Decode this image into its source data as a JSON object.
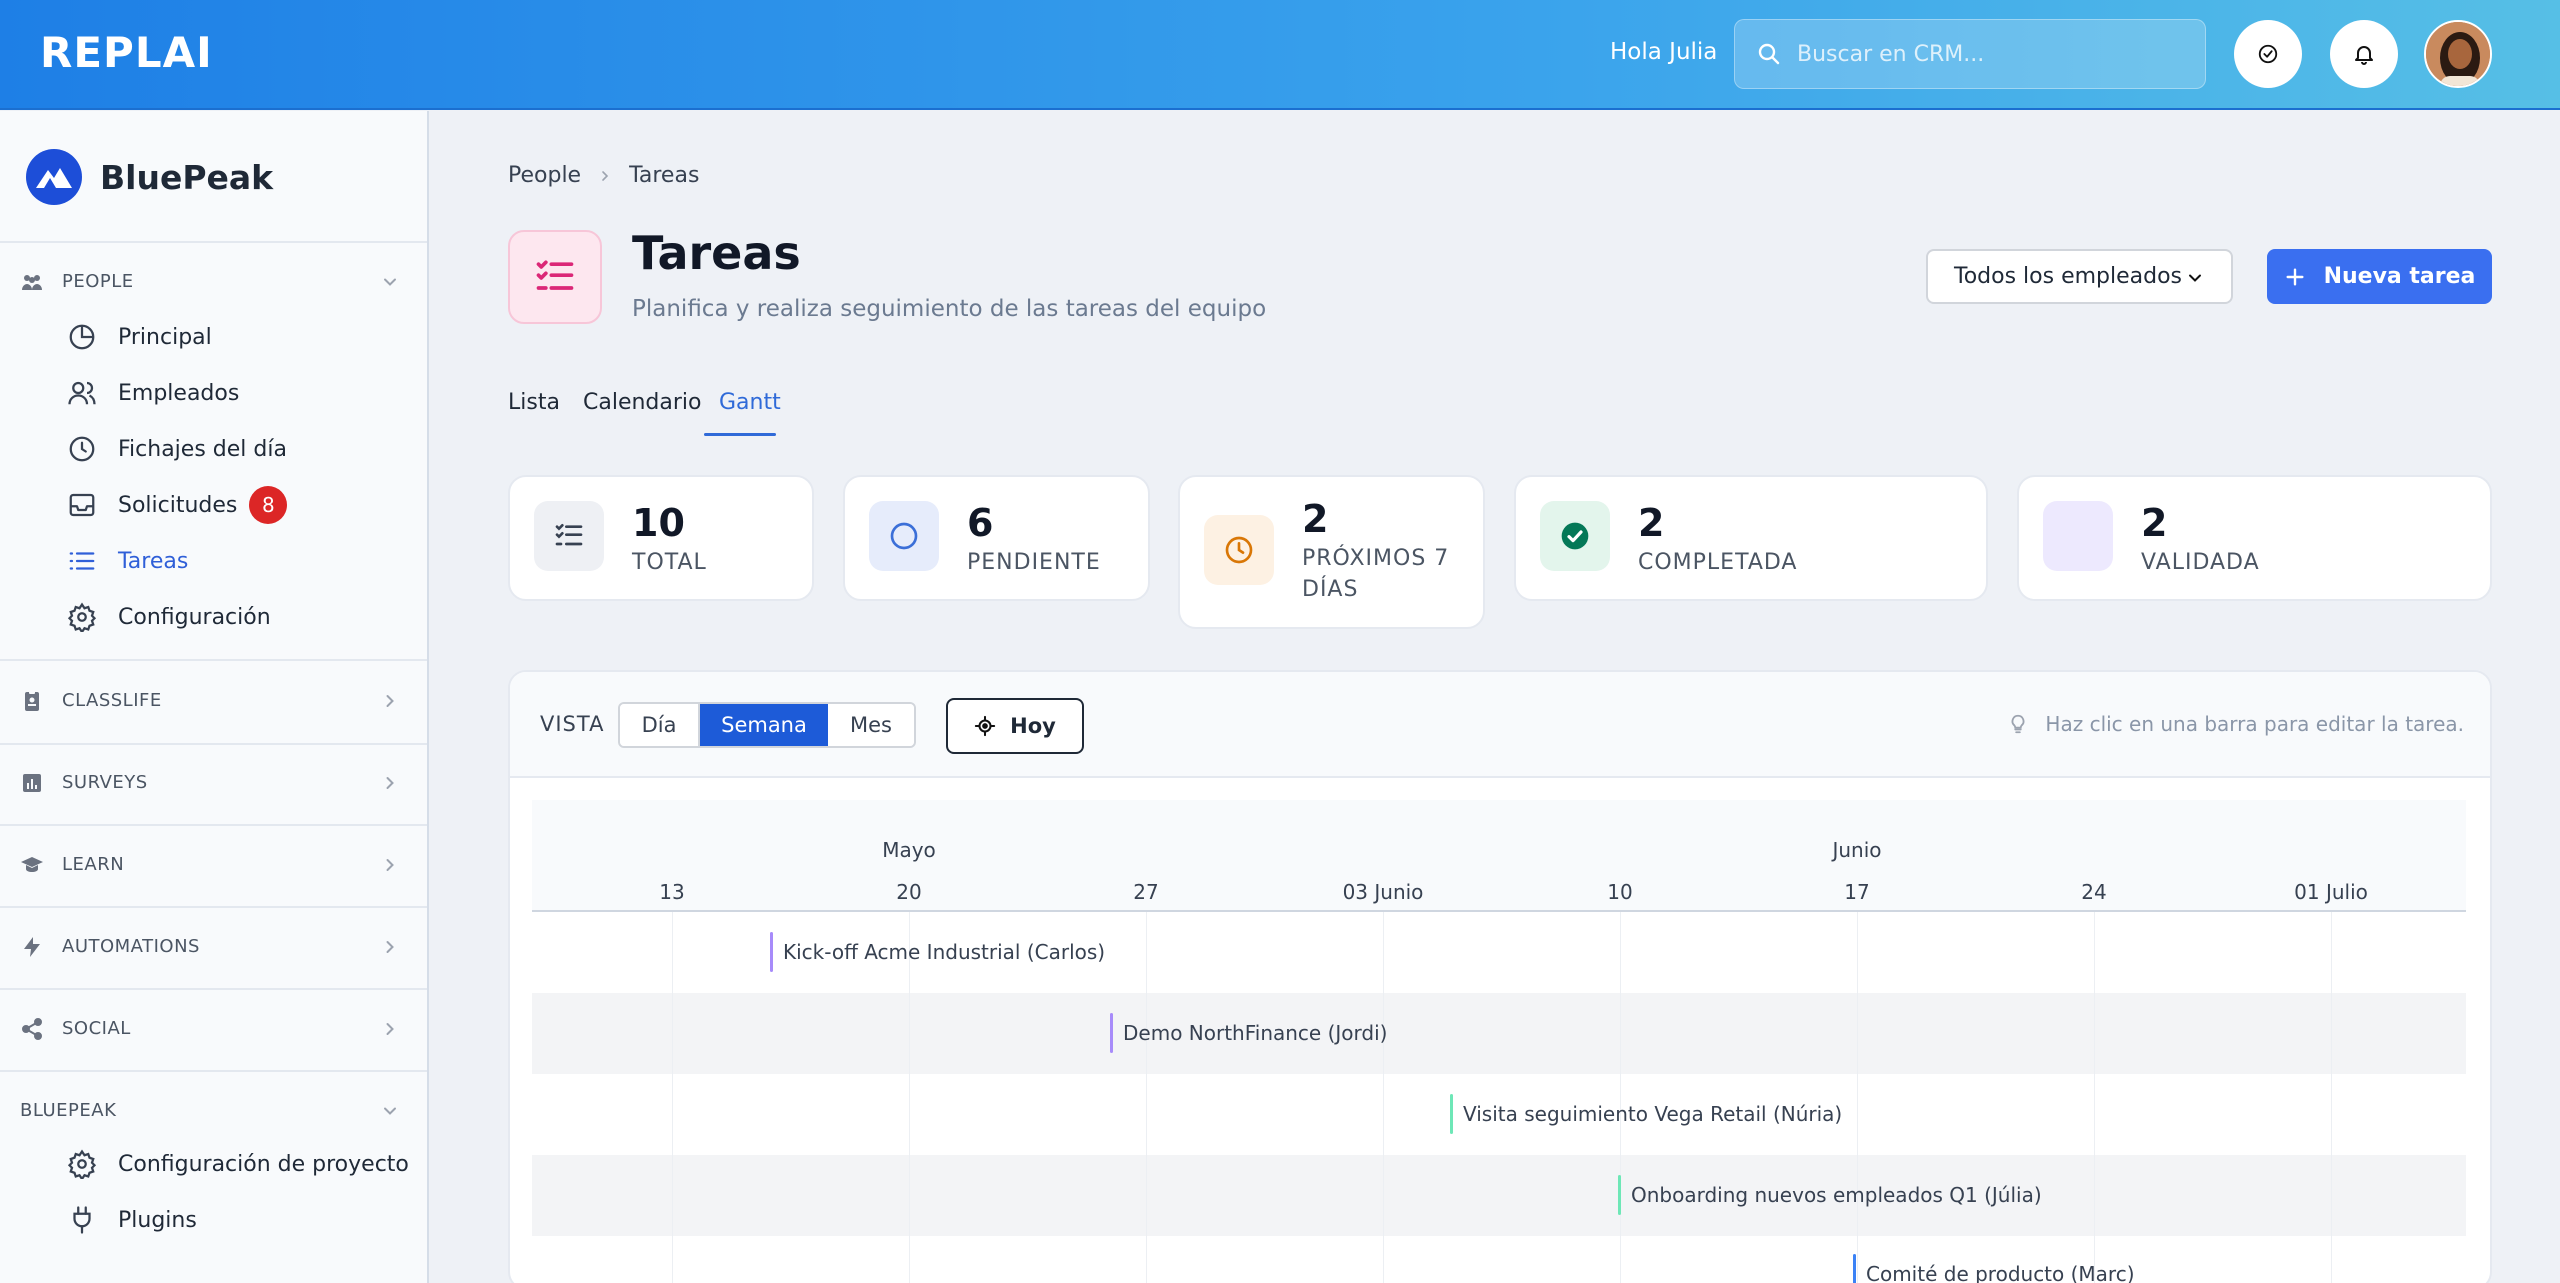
{
  "app": {
    "logo_text": "REPLAI",
    "greeting": "Hola Julia",
    "search_placeholder": "Buscar en CRM..."
  },
  "sidebar": {
    "brand": "BluePeak",
    "people_section": {
      "label": "PEOPLE",
      "items": [
        {
          "label": "Principal",
          "icon": "pie-chart-icon"
        },
        {
          "label": "Empleados",
          "icon": "users-icon"
        },
        {
          "label": "Fichajes del día",
          "icon": "clock-icon"
        },
        {
          "label": "Solicitudes",
          "icon": "inbox-icon",
          "badge": "8"
        },
        {
          "label": "Tareas",
          "icon": "list-icon",
          "active": true
        },
        {
          "label": "Configuración",
          "icon": "gear-icon"
        }
      ]
    },
    "collapsed_sections": [
      {
        "label": "CLASSLIFE",
        "icon": "badge-icon"
      },
      {
        "label": "SURVEYS",
        "icon": "bar-chart-icon"
      },
      {
        "label": "LEARN",
        "icon": "graduation-cap-icon"
      },
      {
        "label": "AUTOMATIONS",
        "icon": "lightning-icon"
      },
      {
        "label": "SOCIAL",
        "icon": "share-icon"
      }
    ],
    "bluepeak_section": {
      "label": "BLUEPEAK",
      "items": [
        {
          "label": "Configuración de proyecto",
          "icon": "gear-icon"
        },
        {
          "label": "Plugins",
          "icon": "plug-icon"
        }
      ]
    }
  },
  "page": {
    "breadcrumb": [
      "People",
      "Tareas"
    ],
    "title": "Tareas",
    "subtitle": "Planifica y realiza seguimiento de las tareas del equipo",
    "employee_filter": "Todos los empleados",
    "new_task_label": "Nueva tarea",
    "tabs": [
      {
        "label": "Lista"
      },
      {
        "label": "Calendario"
      },
      {
        "label": "Gantt",
        "active": true
      }
    ],
    "stats": [
      {
        "value": "10",
        "label": "TOTAL",
        "icon": "checklist-icon"
      },
      {
        "value": "6",
        "label": "PENDIENTE",
        "icon": "circle-icon"
      },
      {
        "value": "2",
        "label": "PRÓXIMOS 7 DÍAS",
        "icon": "clock-icon"
      },
      {
        "value": "2",
        "label": "COMPLETADA",
        "icon": "check-circle-icon"
      },
      {
        "value": "2",
        "label": "VALIDADA",
        "icon": "blank-icon"
      }
    ]
  },
  "gantt": {
    "view_label": "VISTA",
    "view_options": [
      "Día",
      "Semana",
      "Mes"
    ],
    "view_selected": "Semana",
    "today_label": "Hoy",
    "hint": "Haz clic en una barra para editar la tarea.",
    "months": [
      "Mayo",
      "Junio"
    ],
    "weeks": [
      "13",
      "20",
      "27",
      "03 Junio",
      "10",
      "17",
      "24",
      "01 Julio"
    ],
    "tasks": [
      {
        "label": "Kick-off Acme Industrial (Carlos)",
        "color": "#a78bfa"
      },
      {
        "label": "Demo NorthFinance (Jordi)",
        "color": "#a78bfa"
      },
      {
        "label": "Visita seguimiento Vega Retail (Núria)",
        "color": "#6ee7b7"
      },
      {
        "label": "Onboarding nuevos empleados Q1 (Júlia)",
        "color": "#6ee7b7"
      },
      {
        "label": "Comité de producto (Marc)",
        "color": "#3b82f6"
      }
    ]
  },
  "colors": {
    "accent": "#3a6ff0",
    "active_nav": "#2f5fd8",
    "badge": "#dc2626",
    "pending": "#3b6fd8",
    "upcoming": "#d97706",
    "completed": "#059669",
    "validated": "#ede9fe"
  }
}
